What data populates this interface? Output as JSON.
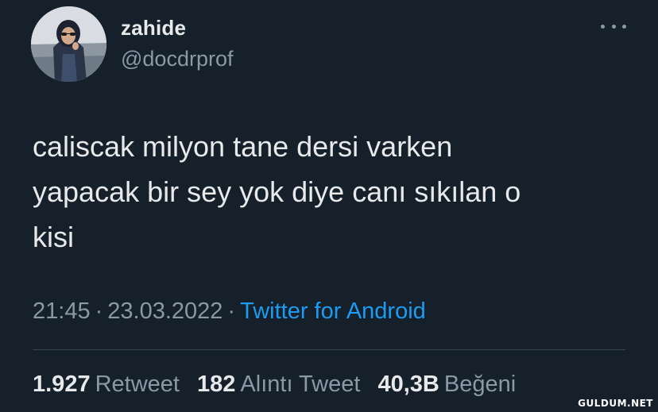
{
  "author": {
    "display_name": "zahide",
    "handle": "@docdrprof"
  },
  "more_icon": "more-horizontal-icon",
  "tweet": {
    "text": "caliscak milyon tane dersi varken\nyapacak bir sey yok diye canı sıkılan o\nkisi"
  },
  "meta": {
    "time": "21:45",
    "separator": "·",
    "date": "23.03.2022",
    "source": "Twitter for Android"
  },
  "stats": {
    "retweets": {
      "count": "1.927",
      "label": "Retweet"
    },
    "quotes": {
      "count": "182",
      "label": "Alıntı Tweet"
    },
    "likes": {
      "count": "40,3B",
      "label": "Beğeni"
    }
  },
  "watermark": "GULDUM.NET",
  "colors": {
    "background": "#15202b",
    "primary_text": "#e7e9ea",
    "secondary_text": "#8b98a5",
    "link": "#1d9bf0",
    "divider": "#38444d"
  }
}
